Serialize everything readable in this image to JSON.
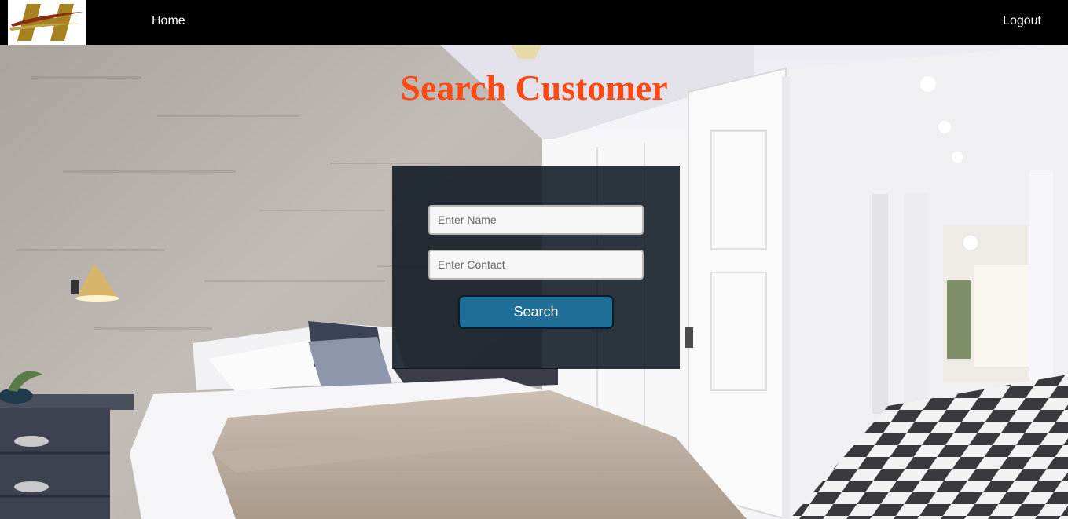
{
  "nav": {
    "logo_letter": "H",
    "home_label": "Home",
    "logout_label": "Logout"
  },
  "page": {
    "title": "Search Customer"
  },
  "form": {
    "name_placeholder": "Enter Name",
    "name_value": "",
    "contact_placeholder": "Enter Contact",
    "contact_value": "",
    "search_label": "Search"
  },
  "colors": {
    "navbar_bg": "#000000",
    "title": "#ff4a14",
    "panel_bg": "#0a141e",
    "button_bg": "#1f6f98",
    "logo_gold": "#a5821f"
  },
  "icons": {
    "logo": "hotel-h-logo"
  }
}
